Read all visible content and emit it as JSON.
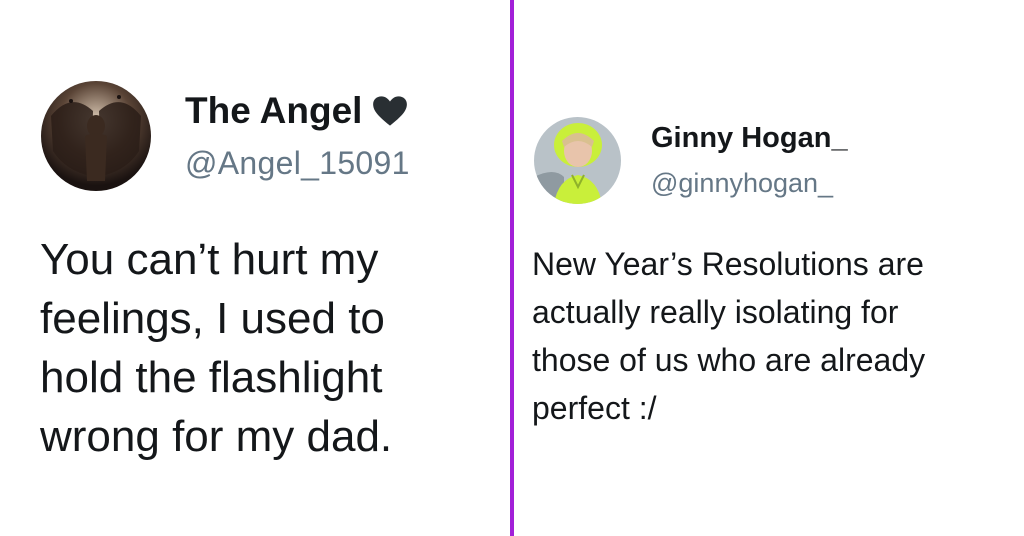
{
  "tweets": [
    {
      "display_name": "The Angel",
      "badge_icon": "black-heart-icon",
      "handle": "@Angel_15091",
      "text_lines": [
        "You can’t hurt my",
        "feelings, I used to",
        "hold the flashlight",
        "wrong for my dad."
      ]
    },
    {
      "display_name": "Ginny Hogan_",
      "handle": "@ginnyhogan_",
      "text_lines": [
        "New Year’s Resolutions are",
        "actually really isolating for",
        "those of us who are already",
        "perfect :/"
      ]
    }
  ],
  "colors": {
    "divider": "#a21fd8",
    "handle": "#657786",
    "text": "#14171a"
  }
}
